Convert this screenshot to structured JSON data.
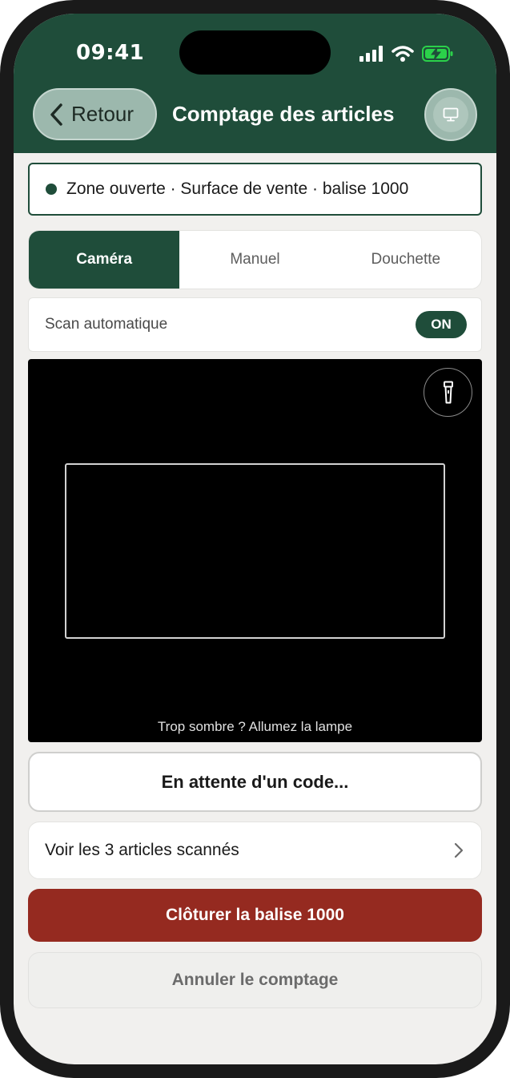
{
  "status_bar": {
    "time": "09:41",
    "icons": [
      "signal-icon",
      "wifi-icon",
      "battery-charging-icon"
    ]
  },
  "header": {
    "back_label": "Retour",
    "title": "Comptage des articles",
    "monitor_icon": "monitor-icon"
  },
  "zone": {
    "text": "Zone ouverte · Surface de vente · balise 1000",
    "status_color": "#1f4d3a"
  },
  "tabs": [
    {
      "label": "Caméra",
      "active": true
    },
    {
      "label": "Manuel",
      "active": false
    },
    {
      "label": "Douchette",
      "active": false
    }
  ],
  "auto_scan": {
    "label": "Scan automatique",
    "toggle_label": "ON"
  },
  "camera": {
    "hint": "Trop sombre ? Allumez la lampe",
    "torch_icon": "flashlight-icon"
  },
  "scan_status": "En attente d'un code...",
  "scanned_link": {
    "label": "Voir les 3 articles scannés"
  },
  "actions": {
    "close_label": "Clôturer la balise 1000",
    "cancel_label": "Annuler le comptage"
  },
  "colors": {
    "brand_green": "#1f4d3a",
    "danger_red": "#952a20",
    "background": "#f1f0ee"
  }
}
